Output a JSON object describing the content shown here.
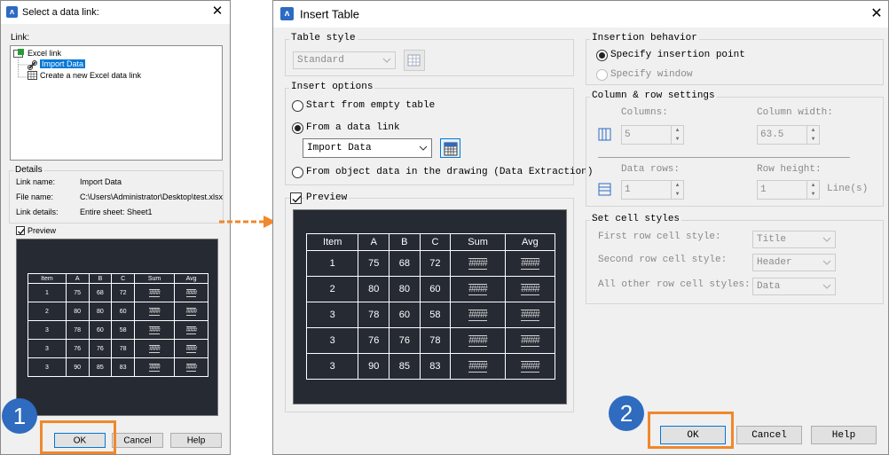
{
  "colors": {
    "accent": "#0078d7",
    "highlight": "#f0882c",
    "badge": "#2f6bbf",
    "preview_bg": "#262a33"
  },
  "left_dialog": {
    "title": "Select a data link:",
    "link_label": "Link:",
    "tree": {
      "root": "Excel link",
      "selected": "Import Data",
      "create": "Create a new Excel data link"
    },
    "details_label": "Details",
    "details": [
      {
        "key": "Link name:",
        "value": "Import Data"
      },
      {
        "key": "File name:",
        "value": "C:\\Users\\Administrator\\Desktop\\test.xlsx"
      },
      {
        "key": "Link details:",
        "value": "Entire sheet: Sheet1"
      }
    ],
    "preview_label": "Preview",
    "buttons": {
      "ok": "OK",
      "cancel": "Cancel",
      "help": "Help"
    }
  },
  "right_dialog": {
    "title": "Insert Table",
    "table_style": {
      "label": "Table style",
      "value": "Standard"
    },
    "insert_options": {
      "label": "Insert options",
      "start_empty": "Start from empty table",
      "from_link": "From a data link",
      "link_value": "Import Data",
      "from_object": "From object data in the drawing (Data Extraction)"
    },
    "preview_label": "Preview",
    "insertion_behavior": {
      "label": "Insertion behavior",
      "specify_point": "Specify insertion point",
      "specify_window": "Specify window"
    },
    "colrow": {
      "label": "Column & row settings",
      "columns_label": "Columns:",
      "columns_value": "5",
      "col_width_label": "Column width:",
      "col_width_value": "63.5",
      "data_rows_label": "Data rows:",
      "data_rows_value": "1",
      "row_height_label": "Row height:",
      "row_height_value": "1",
      "row_height_unit": "Line(s)"
    },
    "cell_styles": {
      "label": "Set cell styles",
      "rows": [
        {
          "label": "First row cell style:",
          "value": "Title"
        },
        {
          "label": "Second row cell style:",
          "value": "Header"
        },
        {
          "label": "All other row cell styles:",
          "value": "Data"
        }
      ]
    },
    "buttons": {
      "ok": "OK",
      "cancel": "Cancel",
      "help": "Help"
    }
  },
  "preview_table": {
    "headers": [
      "Item",
      "A",
      "B",
      "C",
      "Sum",
      "Avg"
    ],
    "rows": [
      [
        "1",
        "75",
        "68",
        "72",
        "####",
        "####"
      ],
      [
        "2",
        "80",
        "80",
        "60",
        "####",
        "####"
      ],
      [
        "3",
        "78",
        "60",
        "58",
        "####",
        "####"
      ],
      [
        "3",
        "76",
        "76",
        "78",
        "####",
        "####"
      ],
      [
        "3",
        "90",
        "85",
        "83",
        "####",
        "####"
      ]
    ]
  },
  "badges": {
    "first": "1",
    "second": "2"
  }
}
